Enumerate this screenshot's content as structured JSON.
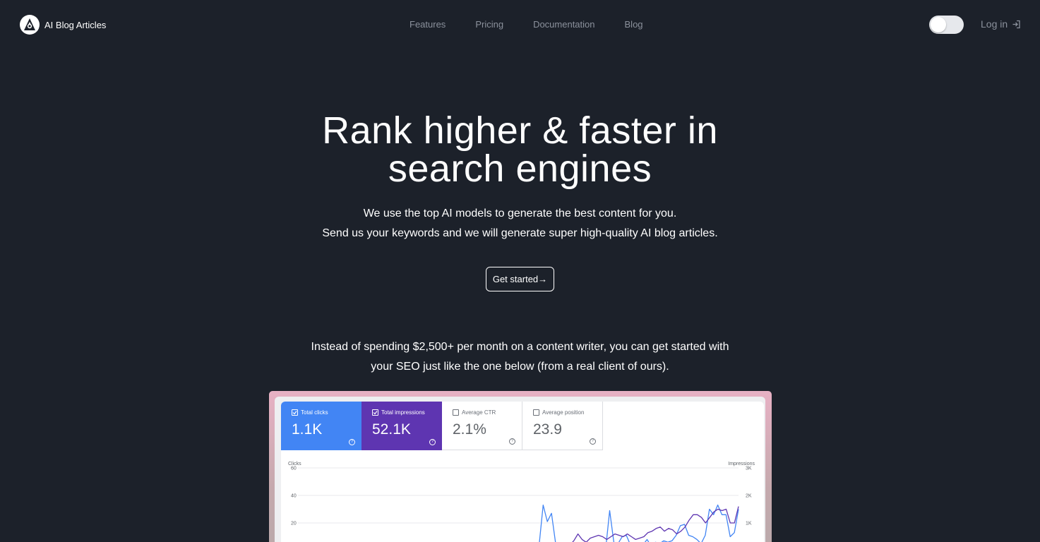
{
  "nav": {
    "brand": "AI Blog Articles",
    "links": [
      "Features",
      "Pricing",
      "Documentation",
      "Blog"
    ],
    "login": "Log in",
    "theme_toggle_icon": "moon-icon"
  },
  "hero": {
    "title_line1": "Rank higher & faster in",
    "title_line2": "search engines",
    "sub_line1": "We use the top AI models to generate the best content for you.",
    "sub_line2": "Send us your keywords and we will generate super high-quality AI blog articles.",
    "cta": "Get started→"
  },
  "pitch": {
    "line1": "Instead of spending $2,500+ per month on a content writer, you can get started with",
    "line2": "your SEO just like the one below (from a real client of ours)."
  },
  "search_console": {
    "metrics": [
      {
        "label": "Total clicks",
        "value": "1.1K",
        "checked": true,
        "color": "#4285f4"
      },
      {
        "label": "Total impressions",
        "value": "52.1K",
        "checked": true,
        "color": "#5e35b1"
      },
      {
        "label": "Average CTR",
        "value": "2.1%",
        "checked": false
      },
      {
        "label": "Average position",
        "value": "23.9",
        "checked": false
      }
    ],
    "chart_data": {
      "type": "line",
      "left_axis_label": "Clicks",
      "right_axis_label": "Impressions",
      "left_ticks": [
        "60",
        "40",
        "20"
      ],
      "right_ticks": [
        "3K",
        "2K",
        "1K"
      ],
      "left_ylim": [
        0,
        60
      ],
      "right_ylim": [
        0,
        3000
      ],
      "series": [
        {
          "color": "#4285f4",
          "axis": "left",
          "values": [
            0,
            0,
            0,
            0,
            0,
            0,
            0,
            0,
            0,
            0,
            0,
            0,
            0,
            0,
            0,
            0,
            0,
            0,
            0,
            0,
            0,
            0,
            0,
            0,
            0,
            0,
            0,
            0,
            0,
            0,
            0,
            0,
            0,
            0,
            0,
            0,
            0,
            0,
            0,
            0,
            0,
            0,
            0,
            0,
            0,
            0,
            0,
            0,
            0,
            0,
            0,
            0,
            0,
            0,
            0,
            0,
            0,
            0,
            3,
            33,
            21,
            27,
            5,
            0,
            0,
            0,
            1,
            0,
            4,
            2,
            3,
            0,
            0,
            1,
            0,
            29,
            6,
            5,
            10,
            11,
            4,
            0,
            5,
            4,
            8,
            3,
            6,
            5,
            7,
            6,
            7,
            11,
            18,
            19,
            11,
            10,
            8,
            5,
            11,
            30,
            26,
            33,
            26,
            26,
            10,
            13,
            30
          ]
        },
        {
          "color": "#5e35b1",
          "axis": "right",
          "values": [
            0,
            0,
            0,
            0,
            0,
            0,
            0,
            0,
            0,
            0,
            0,
            0,
            0,
            0,
            0,
            0,
            0,
            0,
            0,
            0,
            0,
            0,
            0,
            0,
            0,
            0,
            0,
            0,
            0,
            0,
            0,
            0,
            0,
            0,
            0,
            0,
            0,
            0,
            0,
            0,
            0,
            0,
            0,
            0,
            0,
            0,
            0,
            0,
            0,
            0,
            0,
            0,
            0,
            0,
            0,
            0,
            0,
            0,
            0,
            0,
            0,
            0,
            0,
            0,
            0,
            0,
            200,
            350,
            600,
            400,
            300,
            450,
            500,
            550,
            500,
            400,
            500,
            600,
            550,
            500,
            600,
            500,
            400,
            450,
            500,
            650,
            700,
            800,
            850,
            700,
            800,
            750,
            600,
            700,
            850,
            1100,
            1300,
            1300,
            1200,
            1000,
            1200,
            1400,
            1500,
            1450,
            1500,
            1000,
            1000,
            1600
          ]
        }
      ]
    }
  }
}
